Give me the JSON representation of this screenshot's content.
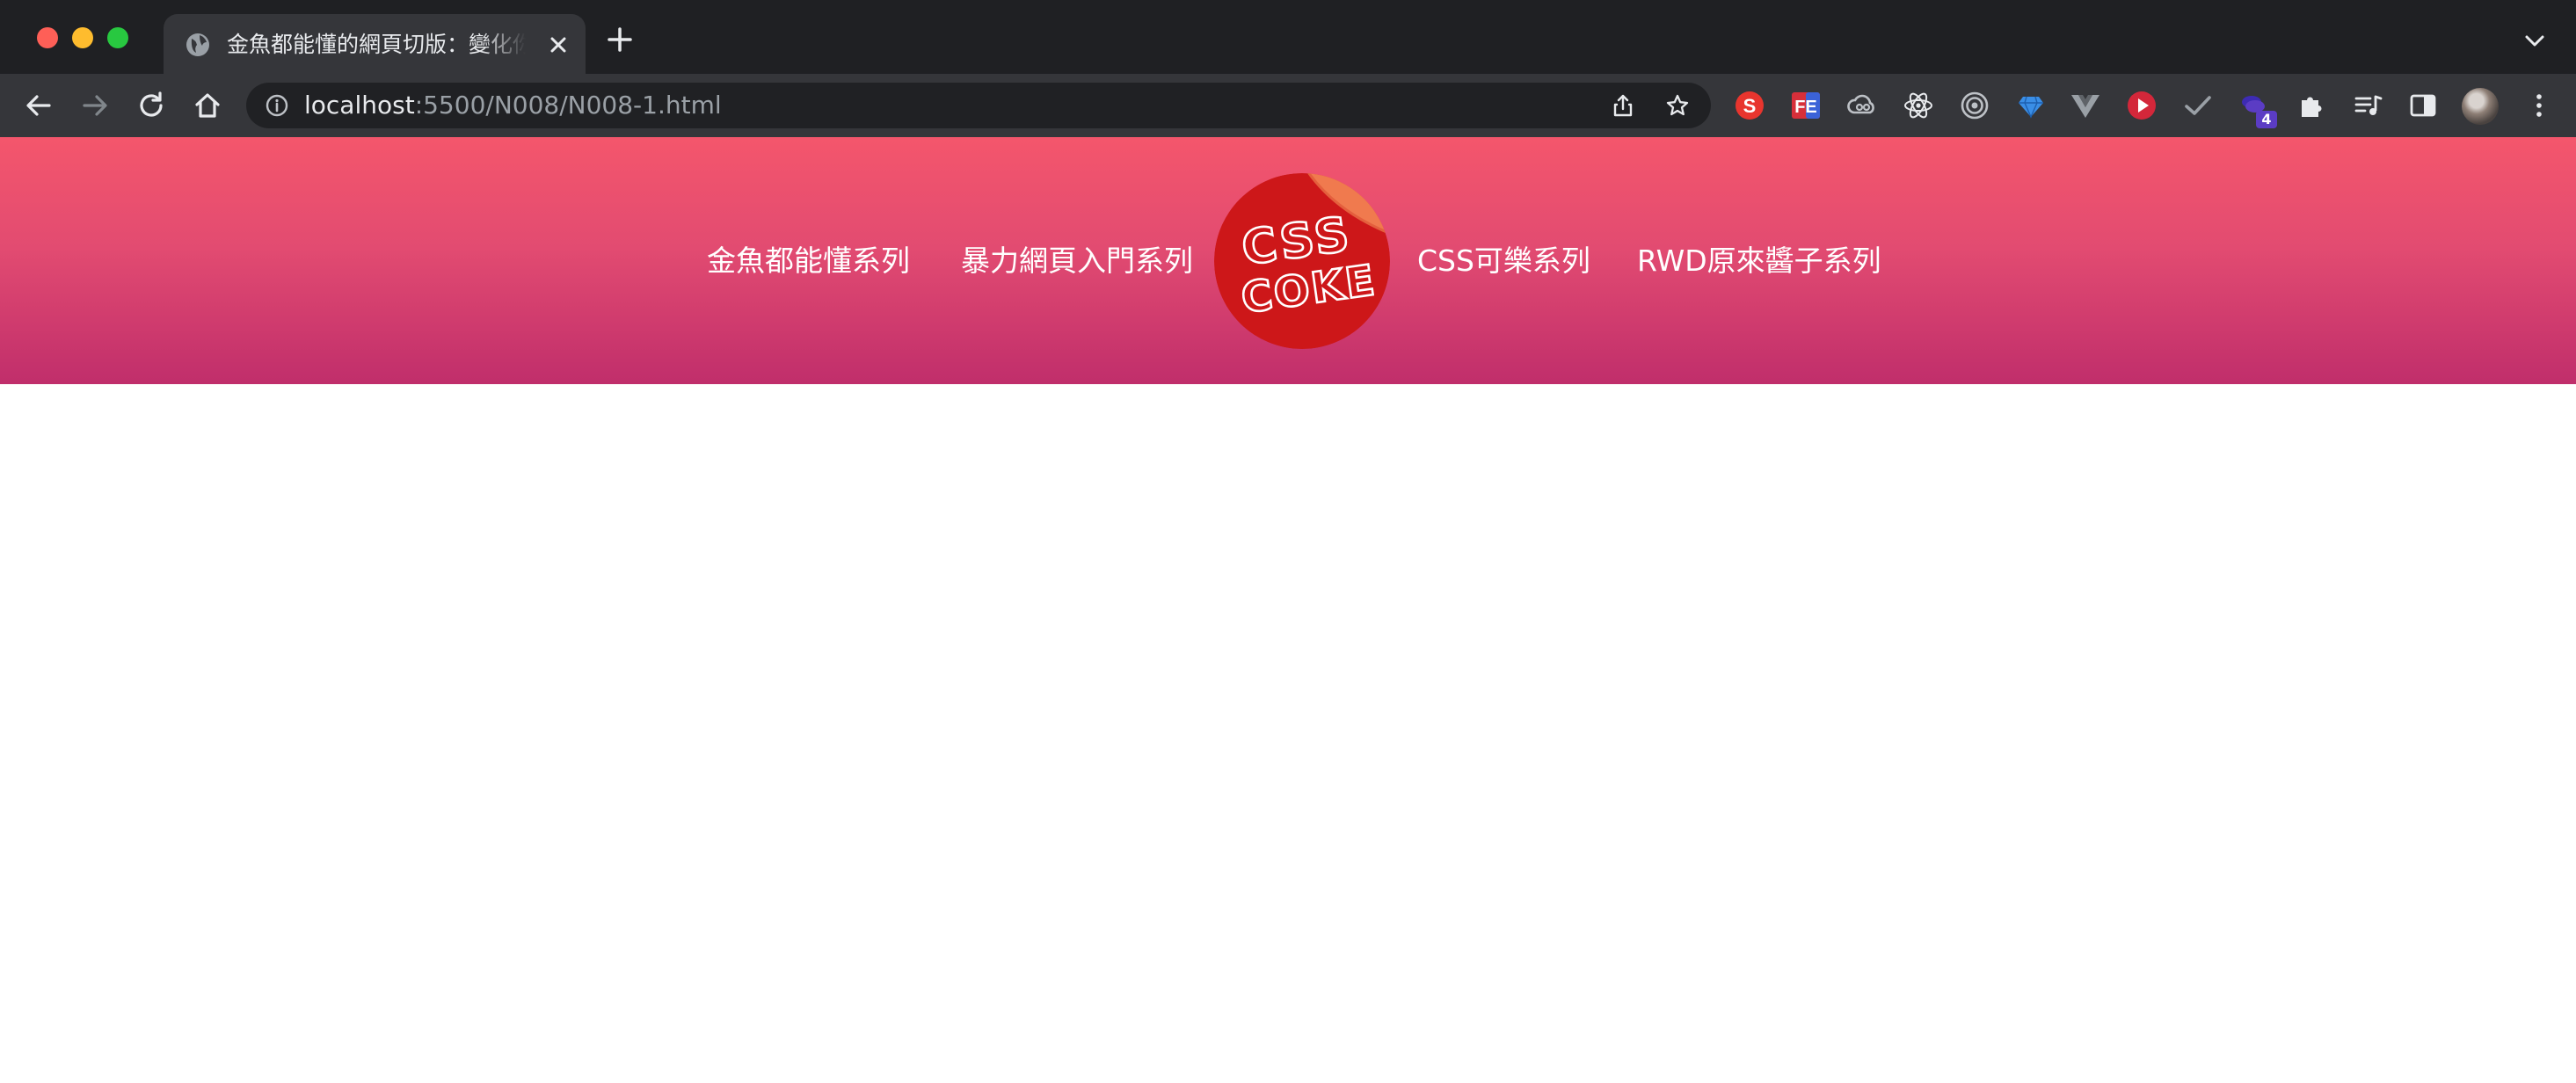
{
  "browser": {
    "tab": {
      "title": "金魚都能懂的網頁切版：變化你的",
      "icon": "globe-icon"
    },
    "address_bar": {
      "host": "localhost",
      "path": ":5500/N008/N008-1.html"
    },
    "extension_badge": "4"
  },
  "site": {
    "nav_left": [
      "金魚都能懂系列",
      "暴力網頁入門系列"
    ],
    "nav_right": [
      "CSS可樂系列",
      "RWD原來醬子系列"
    ],
    "logo": {
      "line1": "CSS",
      "line2": "COKE"
    },
    "colors": {
      "header_top": "#f4566c",
      "header_bottom": "#c02e6b",
      "logo_red": "#cd1719",
      "logo_peel": "#f07a4e"
    }
  }
}
